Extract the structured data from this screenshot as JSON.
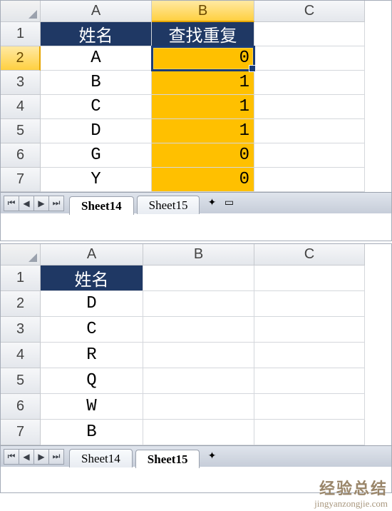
{
  "top": {
    "columns": [
      "A",
      "B",
      "C"
    ],
    "rows": [
      "1",
      "2",
      "3",
      "4",
      "5",
      "6",
      "7"
    ],
    "active_col_index": 1,
    "active_row_index": 1,
    "header_row": {
      "A": "姓名",
      "B": "查找重复"
    },
    "data": [
      {
        "A": "A",
        "B": "0"
      },
      {
        "A": "B",
        "B": "1"
      },
      {
        "A": "C",
        "B": "1"
      },
      {
        "A": "D",
        "B": "1"
      },
      {
        "A": "G",
        "B": "0"
      },
      {
        "A": "Y",
        "B": "0"
      }
    ],
    "highlight_column": "B",
    "tabs": {
      "items": [
        "Sheet14",
        "Sheet15"
      ],
      "active": "Sheet14"
    }
  },
  "bottom": {
    "columns": [
      "A",
      "B",
      "C"
    ],
    "rows": [
      "1",
      "2",
      "3",
      "4",
      "5",
      "6",
      "7"
    ],
    "header_row": {
      "A": "姓名"
    },
    "data": [
      {
        "A": "D"
      },
      {
        "A": "C"
      },
      {
        "A": "R"
      },
      {
        "A": "Q"
      },
      {
        "A": "W"
      },
      {
        "A": "B"
      }
    ],
    "tabs": {
      "items": [
        "Sheet14",
        "Sheet15"
      ],
      "active": "Sheet15"
    }
  },
  "nav_glyphs": {
    "first": "⏮",
    "prev": "◀",
    "next": "▶",
    "last": "⏭"
  },
  "icons": {
    "new_sheet": "✦",
    "scroll": "▭"
  },
  "watermark": {
    "line1": "经验总结",
    "line2": "jingyanzongjie.com"
  }
}
